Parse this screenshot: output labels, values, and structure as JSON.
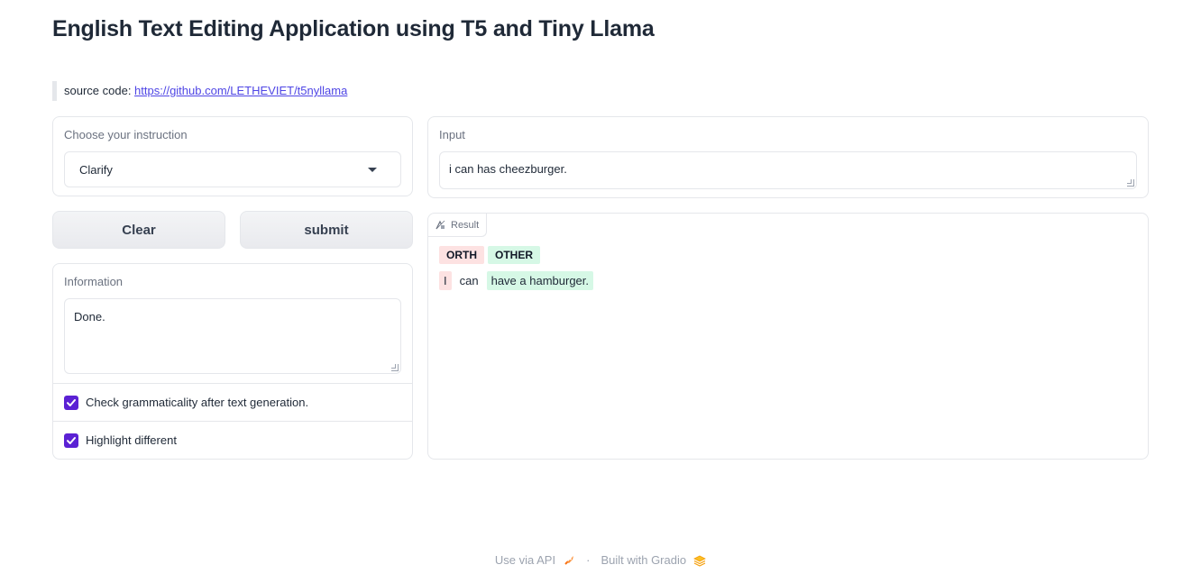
{
  "page": {
    "title": "English Text Editing Application using T5 and Tiny Llama",
    "source_label": "source code: ",
    "source_link": "https://github.com/LETHEVIET/t5nyllama"
  },
  "instruction": {
    "label": "Choose your instruction",
    "selected": "Clarify"
  },
  "input": {
    "label": "Input",
    "value": "i can has cheezburger."
  },
  "buttons": {
    "clear": "Clear",
    "submit": "submit"
  },
  "information": {
    "label": "Information",
    "value": "Done.",
    "check_grammar": "Check grammaticality after text generation.",
    "highlight": "Highlight different"
  },
  "result": {
    "tab_label": "Result",
    "legend": [
      {
        "label": "ORTH",
        "color": "#fde2e2"
      },
      {
        "label": "OTHER",
        "color": "#d6f8e6"
      }
    ],
    "tokens": [
      {
        "text": "I",
        "tag": "ORTH"
      },
      {
        "text": "can",
        "tag": ""
      },
      {
        "text": "have a hamburger.",
        "tag": "OTHER"
      }
    ]
  },
  "footer": {
    "api": "Use via API",
    "separator": "·",
    "built": "Built with Gradio"
  },
  "colors": {
    "accent": "#5b21d4",
    "link": "#4f46e5"
  }
}
